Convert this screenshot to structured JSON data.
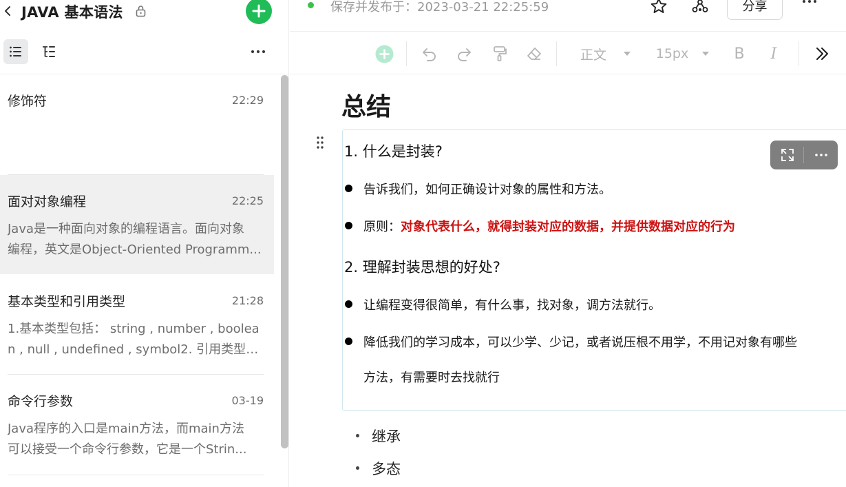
{
  "sidebar": {
    "notebook_title": "JAVA 基本语法",
    "notes": [
      {
        "title": "修饰符",
        "time": "22:29",
        "preview": []
      },
      {
        "title": "面对对象编程",
        "time": "22:25",
        "preview": [
          "Java是一种面向对象的编程语言。面向对象",
          "编程，英文是Object-Oriented Programm..."
        ]
      },
      {
        "title": "基本类型和引用类型",
        "time": "21:28",
        "preview": [
          "1.基本类型包括： string , number , boolea",
          "n , null , undefined , symbol2. 引用类型包..."
        ]
      },
      {
        "title": "命令行参数",
        "time": "03-19",
        "preview": [
          "Java程序的入口是main方法，而main方法",
          "可以接受一个命令行参数，它是一个Strin..."
        ]
      }
    ]
  },
  "topbar": {
    "save_status": "保存并发布于：2023-03-21 22:25:59",
    "share_label": "分享"
  },
  "toolbar": {
    "paragraph_style": "正文",
    "font_size": "15px",
    "bold_label": "B",
    "italic_label": "I"
  },
  "document": {
    "heading": "总结",
    "image_block": {
      "q1": "1.  什么是封装?",
      "q1_b1": "告诉我们，如何正确设计对象的属性和方法。",
      "q1_b2_prefix": "原则：",
      "q1_b2_emphasis": "对象代表什么，就得封装对应的数据，并提供数据对应的行为",
      "q2": "2.  理解封装思想的好处?",
      "q2_b1": "让编程变得很简单，有什么事，找对象，调方法就行。",
      "q2_b2_line1": "降低我们的学习成本，可以少学、少记，或者说压根不用学，不用记对象有哪些",
      "q2_b2_line2": "方法，有需要时去找就行"
    },
    "bullets": [
      "继承",
      "多态"
    ]
  },
  "colors": {
    "accent_green": "#1fbc57",
    "status_dot": "#3cc14a",
    "emphasis_red": "#cc1212",
    "active_note_bg": "#eff0ef"
  }
}
